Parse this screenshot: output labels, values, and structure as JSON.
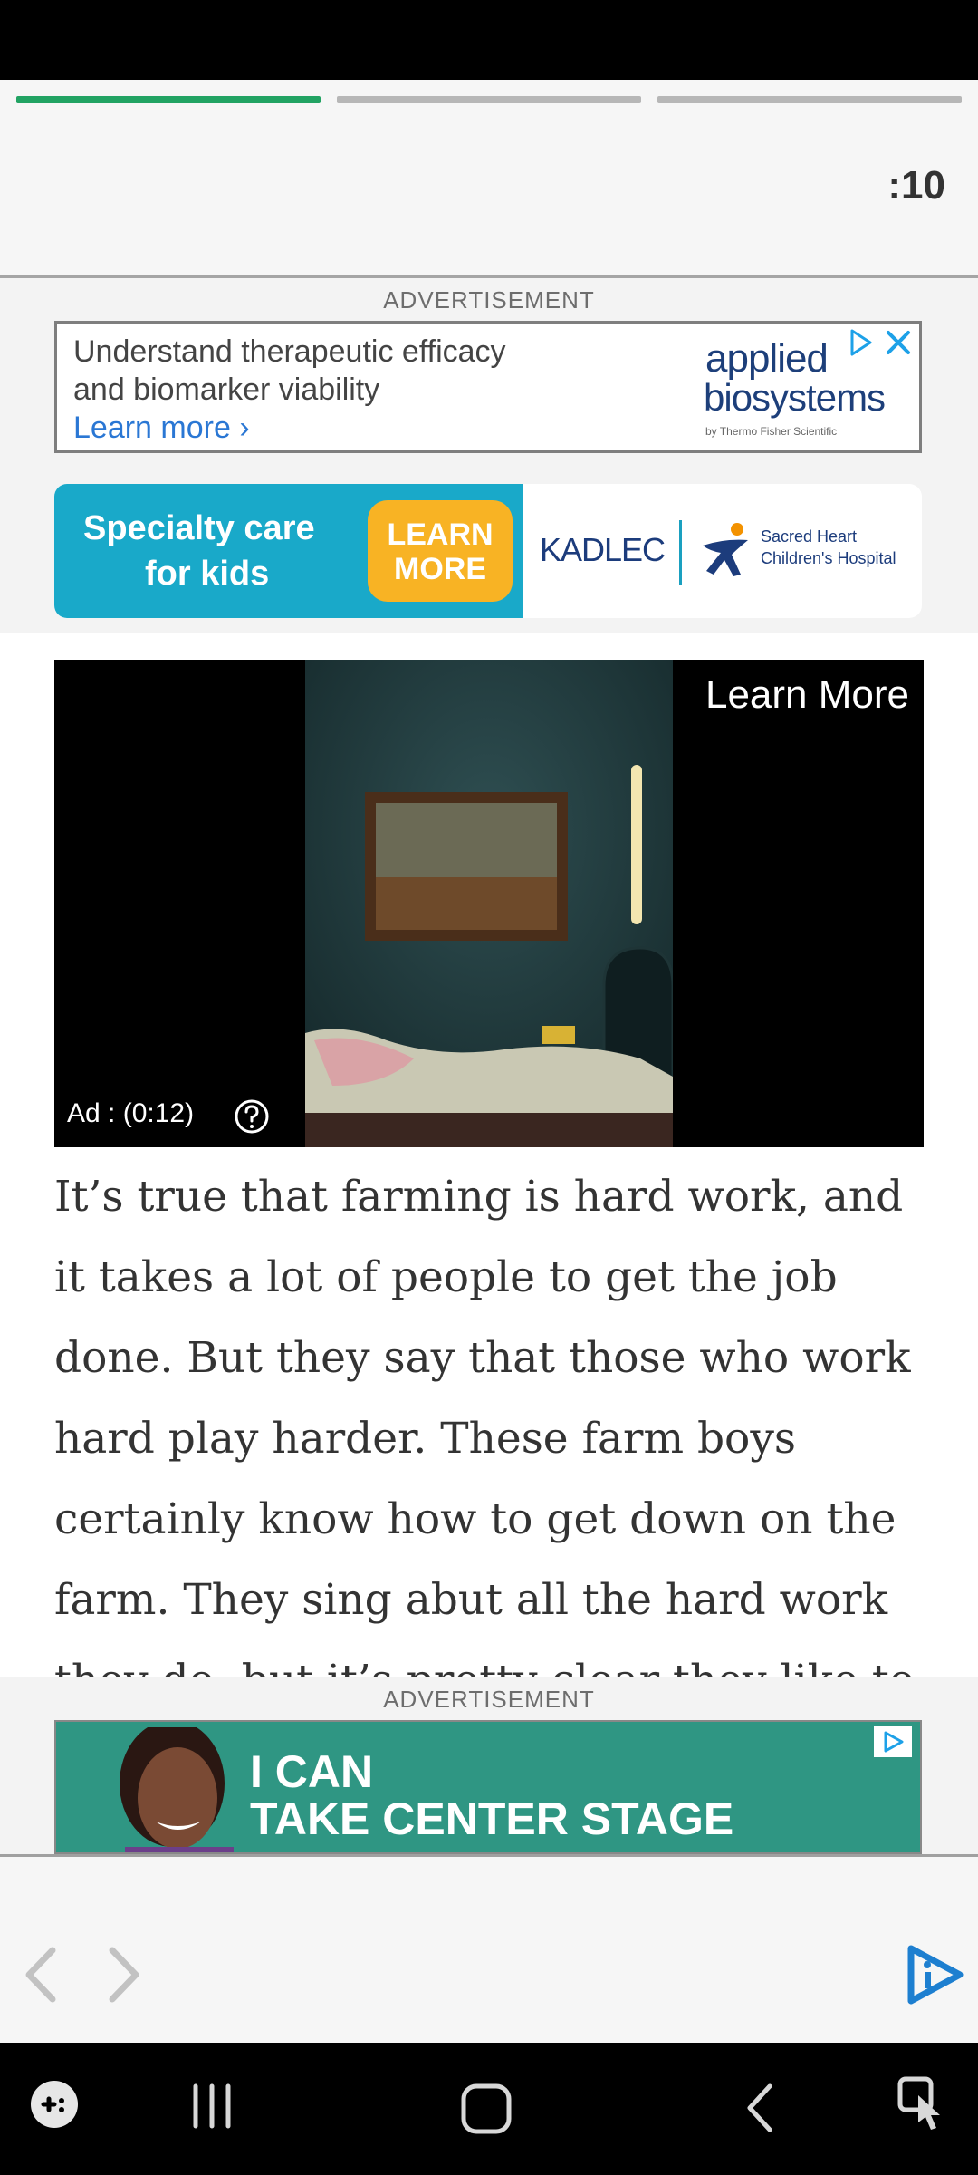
{
  "header": {
    "timer": ":10",
    "progress": [
      {
        "state": "complete",
        "color": "#22a363"
      },
      {
        "state": "pending",
        "color": "#b7b7b7"
      },
      {
        "state": "pending",
        "color": "#b7b7b7"
      }
    ]
  },
  "ads": {
    "label_top": "ADVERTISEMENT",
    "applied": {
      "line1": "Understand therapeutic efficacy",
      "line2": "and biomarker viability",
      "learn_more": "Learn more ›",
      "logo_line1": "applied",
      "logo_line2": "biosystems",
      "tagline": "by Thermo Fisher Scientific"
    },
    "kadlec": {
      "text_line1": "Specialty care",
      "text_line2": "for kids",
      "button_line1": "LEARN",
      "button_line2": "MORE",
      "brand": "KADLEC",
      "hospital_line1": "Sacred Heart",
      "hospital_line2": "Children's Hospital",
      "accent": "#19a9c9",
      "button_color": "#f8b324"
    },
    "label_bottom": "ADVERTISEMENT",
    "stage": {
      "line1": "I CAN",
      "line2": "TAKE CENTER STAGE",
      "background": "#2f9683"
    }
  },
  "video": {
    "learn_more": "Learn More",
    "ad_timer": "Ad : (0:12)",
    "help_icon": "question-circle-icon"
  },
  "article": {
    "text": "It’s true that farming is hard work, and it takes a lot of people to get the job done. But they say that those who work hard play harder. These farm boys certainly know how to get down on the farm. They sing abut all the hard work they do, but it’s pretty clear they like to"
  },
  "nav": {
    "prev_icon": "chevron-left-icon",
    "next_icon": "chevron-right-icon",
    "logo_icon": "inline-logo-icon",
    "system": [
      "game-launcher-icon",
      "recents-icon",
      "home-icon",
      "back-icon",
      "screen-touch-icon"
    ]
  }
}
